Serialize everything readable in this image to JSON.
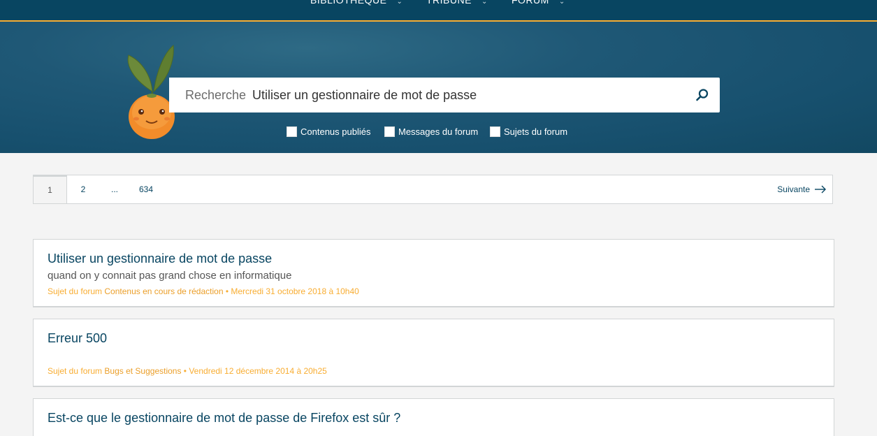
{
  "nav": {
    "items": [
      {
        "label": "BIBLIOTHÈQUE"
      },
      {
        "label": "TRIBUNE"
      },
      {
        "label": "FORUM"
      }
    ]
  },
  "search": {
    "label": "Recherche",
    "value": "Utiliser un gestionnaire de mot de passe"
  },
  "filters": [
    {
      "label": "Contenus publiés",
      "checked": false
    },
    {
      "label": "Messages du forum",
      "checked": false
    },
    {
      "label": "Sujets du forum",
      "checked": false
    }
  ],
  "pagination": {
    "pages": [
      "1",
      "2",
      "...",
      "634"
    ],
    "current": "1",
    "next_label": "Suivante"
  },
  "results": [
    {
      "title": "Utiliser un gestionnaire de mot de passe",
      "description": "quand on y connait pas grand chose en informatique",
      "meta_prefix": "Sujet du forum",
      "category": "Contenus en cours de rédaction",
      "date": " • Mercredi 31 octobre 2018 à 10h40"
    },
    {
      "title": "Erreur 500",
      "description": "",
      "meta_prefix": "Sujet du forum",
      "category": "Bugs et Suggestions",
      "date": " • Vendredi 12 décembre 2014 à 20h25"
    },
    {
      "title": "Est-ce que le gestionnaire de mot de passe de Firefox est sûr ?",
      "description": "",
      "meta_prefix": "",
      "category": "",
      "date": ""
    }
  ],
  "colors": {
    "nav_bg": "#084561",
    "accent": "#f8ad32",
    "link": "#084561"
  }
}
